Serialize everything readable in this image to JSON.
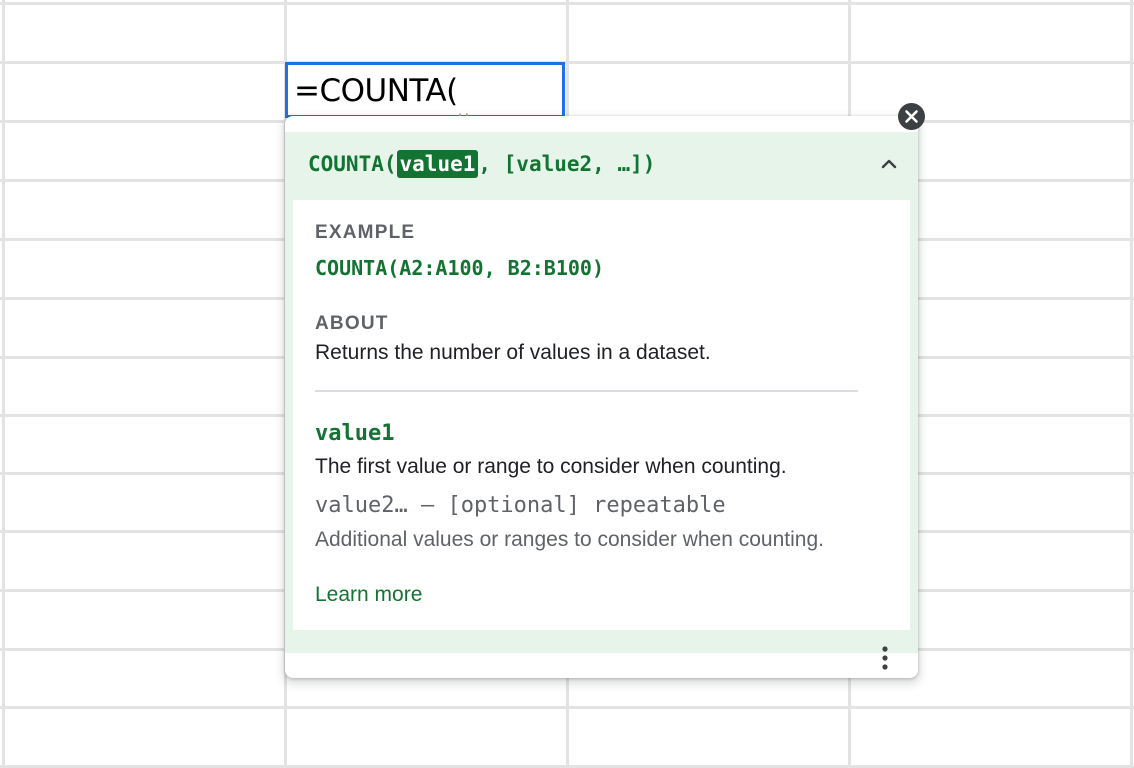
{
  "cell": {
    "formula": "=COUNTA(",
    "caret_glyph": "␣"
  },
  "help": {
    "signature": {
      "func_open": "COUNTA(",
      "active_arg": "value1",
      "rest": ", [value2, …])"
    },
    "example_heading": "EXAMPLE",
    "example_code": "COUNTA(A2:A100, B2:B100)",
    "about_heading": "ABOUT",
    "about_text": "Returns the number of values in a dataset.",
    "args": [
      {
        "name": "value1",
        "description": "The first value or range to consider when counting."
      },
      {
        "name": "value2… – [optional] repeatable",
        "description": "Additional values or ranges to consider when counting."
      }
    ],
    "learn_more": "Learn more"
  },
  "icons": {
    "close": "close-icon",
    "collapse": "chevron-up-icon",
    "more": "more-vert-icon"
  },
  "colors": {
    "accent_green": "#137333",
    "panel_green": "#e6f4ea",
    "selection_blue": "#1a73e8",
    "text_dark": "#202124",
    "text_grey": "#5f6368"
  }
}
